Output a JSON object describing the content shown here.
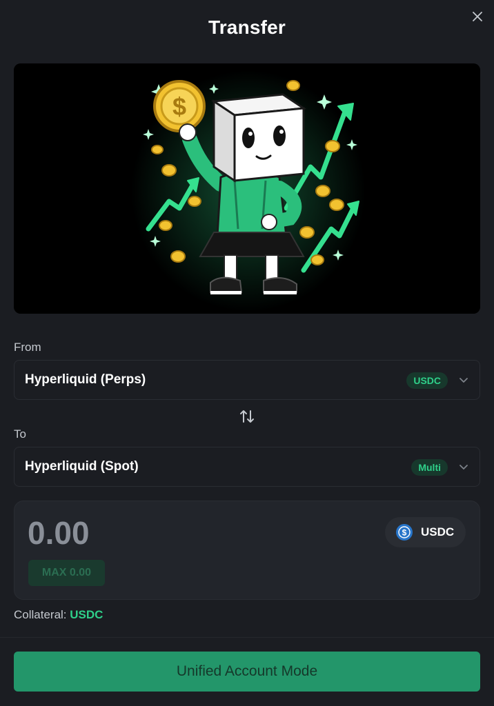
{
  "dialog": {
    "title": "Transfer",
    "close_icon": "close-icon"
  },
  "hero": {
    "image_description_icon": "mascot-illustration",
    "accent_color": "#35e08f",
    "coin_color": "#f2c230"
  },
  "from": {
    "label": "From",
    "value": "Hyperliquid (Perps)",
    "badge": "USDC"
  },
  "swap": {
    "icon": "swap-vertical-icon"
  },
  "to": {
    "label": "To",
    "value": "Hyperliquid (Spot)",
    "badge": "Multi"
  },
  "amount": {
    "placeholder": "0.00",
    "max_label": "MAX 0.00",
    "token": "USDC",
    "token_icon": "usdc-icon"
  },
  "collateral": {
    "label": "Collateral:",
    "value": "USDC"
  },
  "action": {
    "label": "Unified Account Mode"
  },
  "colors": {
    "background": "#1b1d22",
    "accent_green": "#2fd08a",
    "button_green": "#23966a"
  }
}
